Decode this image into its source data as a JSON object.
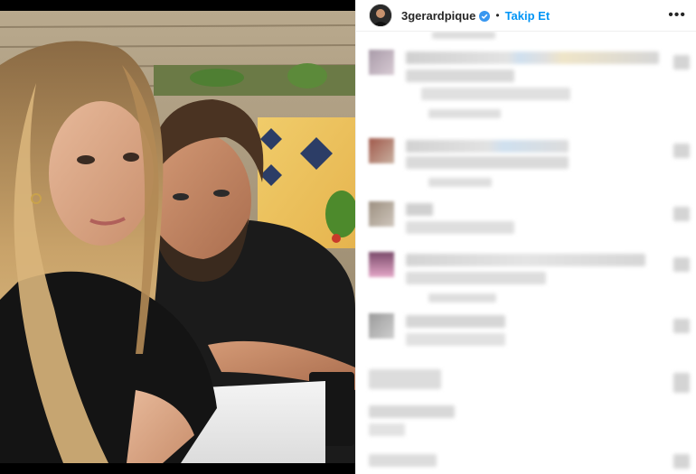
{
  "post": {
    "username": "3gerardpique",
    "verified": true,
    "separator": "•",
    "follow_label": "Takip Et",
    "more_icon": "more-horizontal-icon",
    "photo_description_icon": "photo-image"
  },
  "colors": {
    "follow_blue": "#0095f6",
    "verified_blue": "#3897f0",
    "text_dark": "#262626"
  }
}
